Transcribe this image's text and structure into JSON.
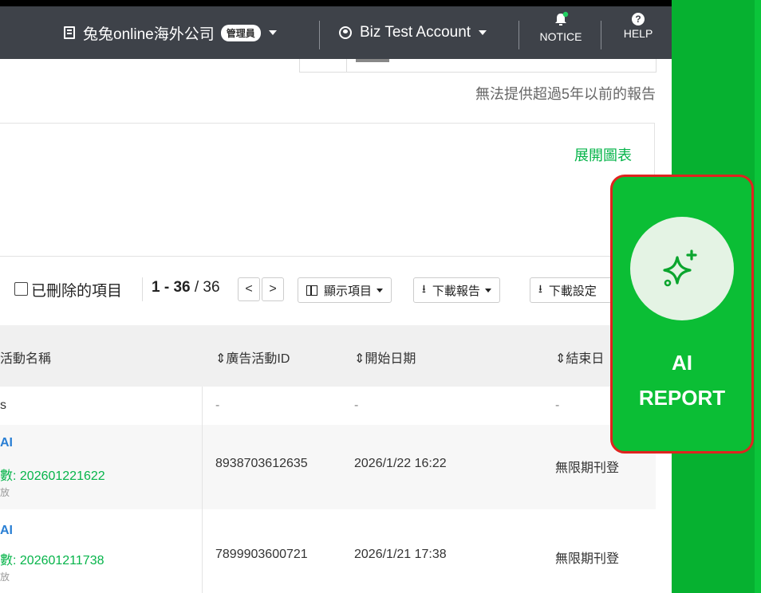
{
  "header": {
    "company": "兔兔online海外公司",
    "role_badge": "管理員",
    "account": "Biz Test Account",
    "notice_label": "NOTICE",
    "help_label": "HELP"
  },
  "notice_text": "無法提供超過5年以前的報告",
  "expand_link": "展開圖表",
  "toolbar": {
    "deleted_items_label": "已刪除的項目",
    "page_range": "1 - 36",
    "page_total": "/ 36",
    "prev_label": "<",
    "next_label": ">",
    "columns_button": "顯示項目",
    "download_report_button": "下載報告",
    "download_settings_button": "下載設定"
  },
  "table": {
    "headers": {
      "name": "活動名稱",
      "campaign_id": "⇕廣告活動ID",
      "start_date": "⇕開始日期",
      "end_date": "⇕結束日"
    },
    "summary_row": {
      "name": "s",
      "campaign_id": "-",
      "start_date": "-",
      "end_date": "-"
    },
    "rows": [
      {
        "tag": "AI",
        "name_link": "數: 202601221622",
        "sub": "放",
        "campaign_id": "8938703612635",
        "start_date": "2026/1/22 16:22",
        "end_date": "無限期刊登"
      },
      {
        "tag": "AI",
        "name_link": "數: 202601211738",
        "sub": "放",
        "campaign_id": "7899903600721",
        "start_date": "2026/1/21 17:38",
        "end_date": "無限期刊登"
      }
    ]
  },
  "ai_report": {
    "line1": "AI",
    "line2": "REPORT"
  },
  "colors": {
    "accent_green": "#06b44a",
    "topbar": "#3e4249",
    "highlight_border": "#e0231f",
    "side_green": "#06b130"
  },
  "icons": [
    "building-icon",
    "user-circle-icon",
    "bell-icon",
    "help-icon",
    "columns-icon",
    "download-icon",
    "sparkle-icon"
  ]
}
